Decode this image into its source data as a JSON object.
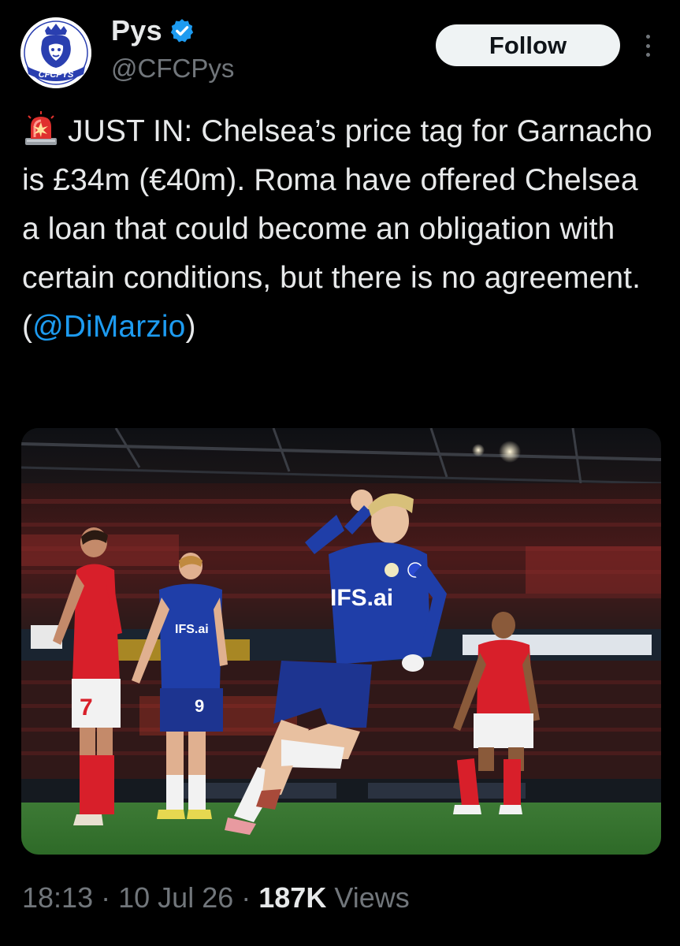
{
  "author": {
    "display_name": "Pys",
    "handle": "@CFCPys",
    "verified": true,
    "avatar_text": "CFCPYS"
  },
  "follow_button": {
    "label": "Follow"
  },
  "tweet": {
    "icon": "police-light-emoji",
    "text_main": "JUST IN: Chelsea’s price tag for Garnacho is £34m (€40m). Roma have offered Chelsea a loan that could become an obligation with certain conditions, but there is no agreement. (",
    "mention": "@DiMarzio",
    "text_end": ")"
  },
  "media": {
    "shirt_sponsor": "IFS.ai",
    "left_player_number": "7",
    "mid_player_number": "9"
  },
  "meta": {
    "time": "18:13",
    "separator": "·",
    "date": "10 Jul 26",
    "views_count": "187K",
    "views_label": "Views"
  },
  "colors": {
    "background": "#000000",
    "text": "#e7e9ea",
    "secondary": "#71767b",
    "link": "#1d9bf0",
    "verified_badge": "#1d9bf0",
    "chelsea_blue": "#1f3ea8",
    "opponent_red": "#d81f2a"
  }
}
